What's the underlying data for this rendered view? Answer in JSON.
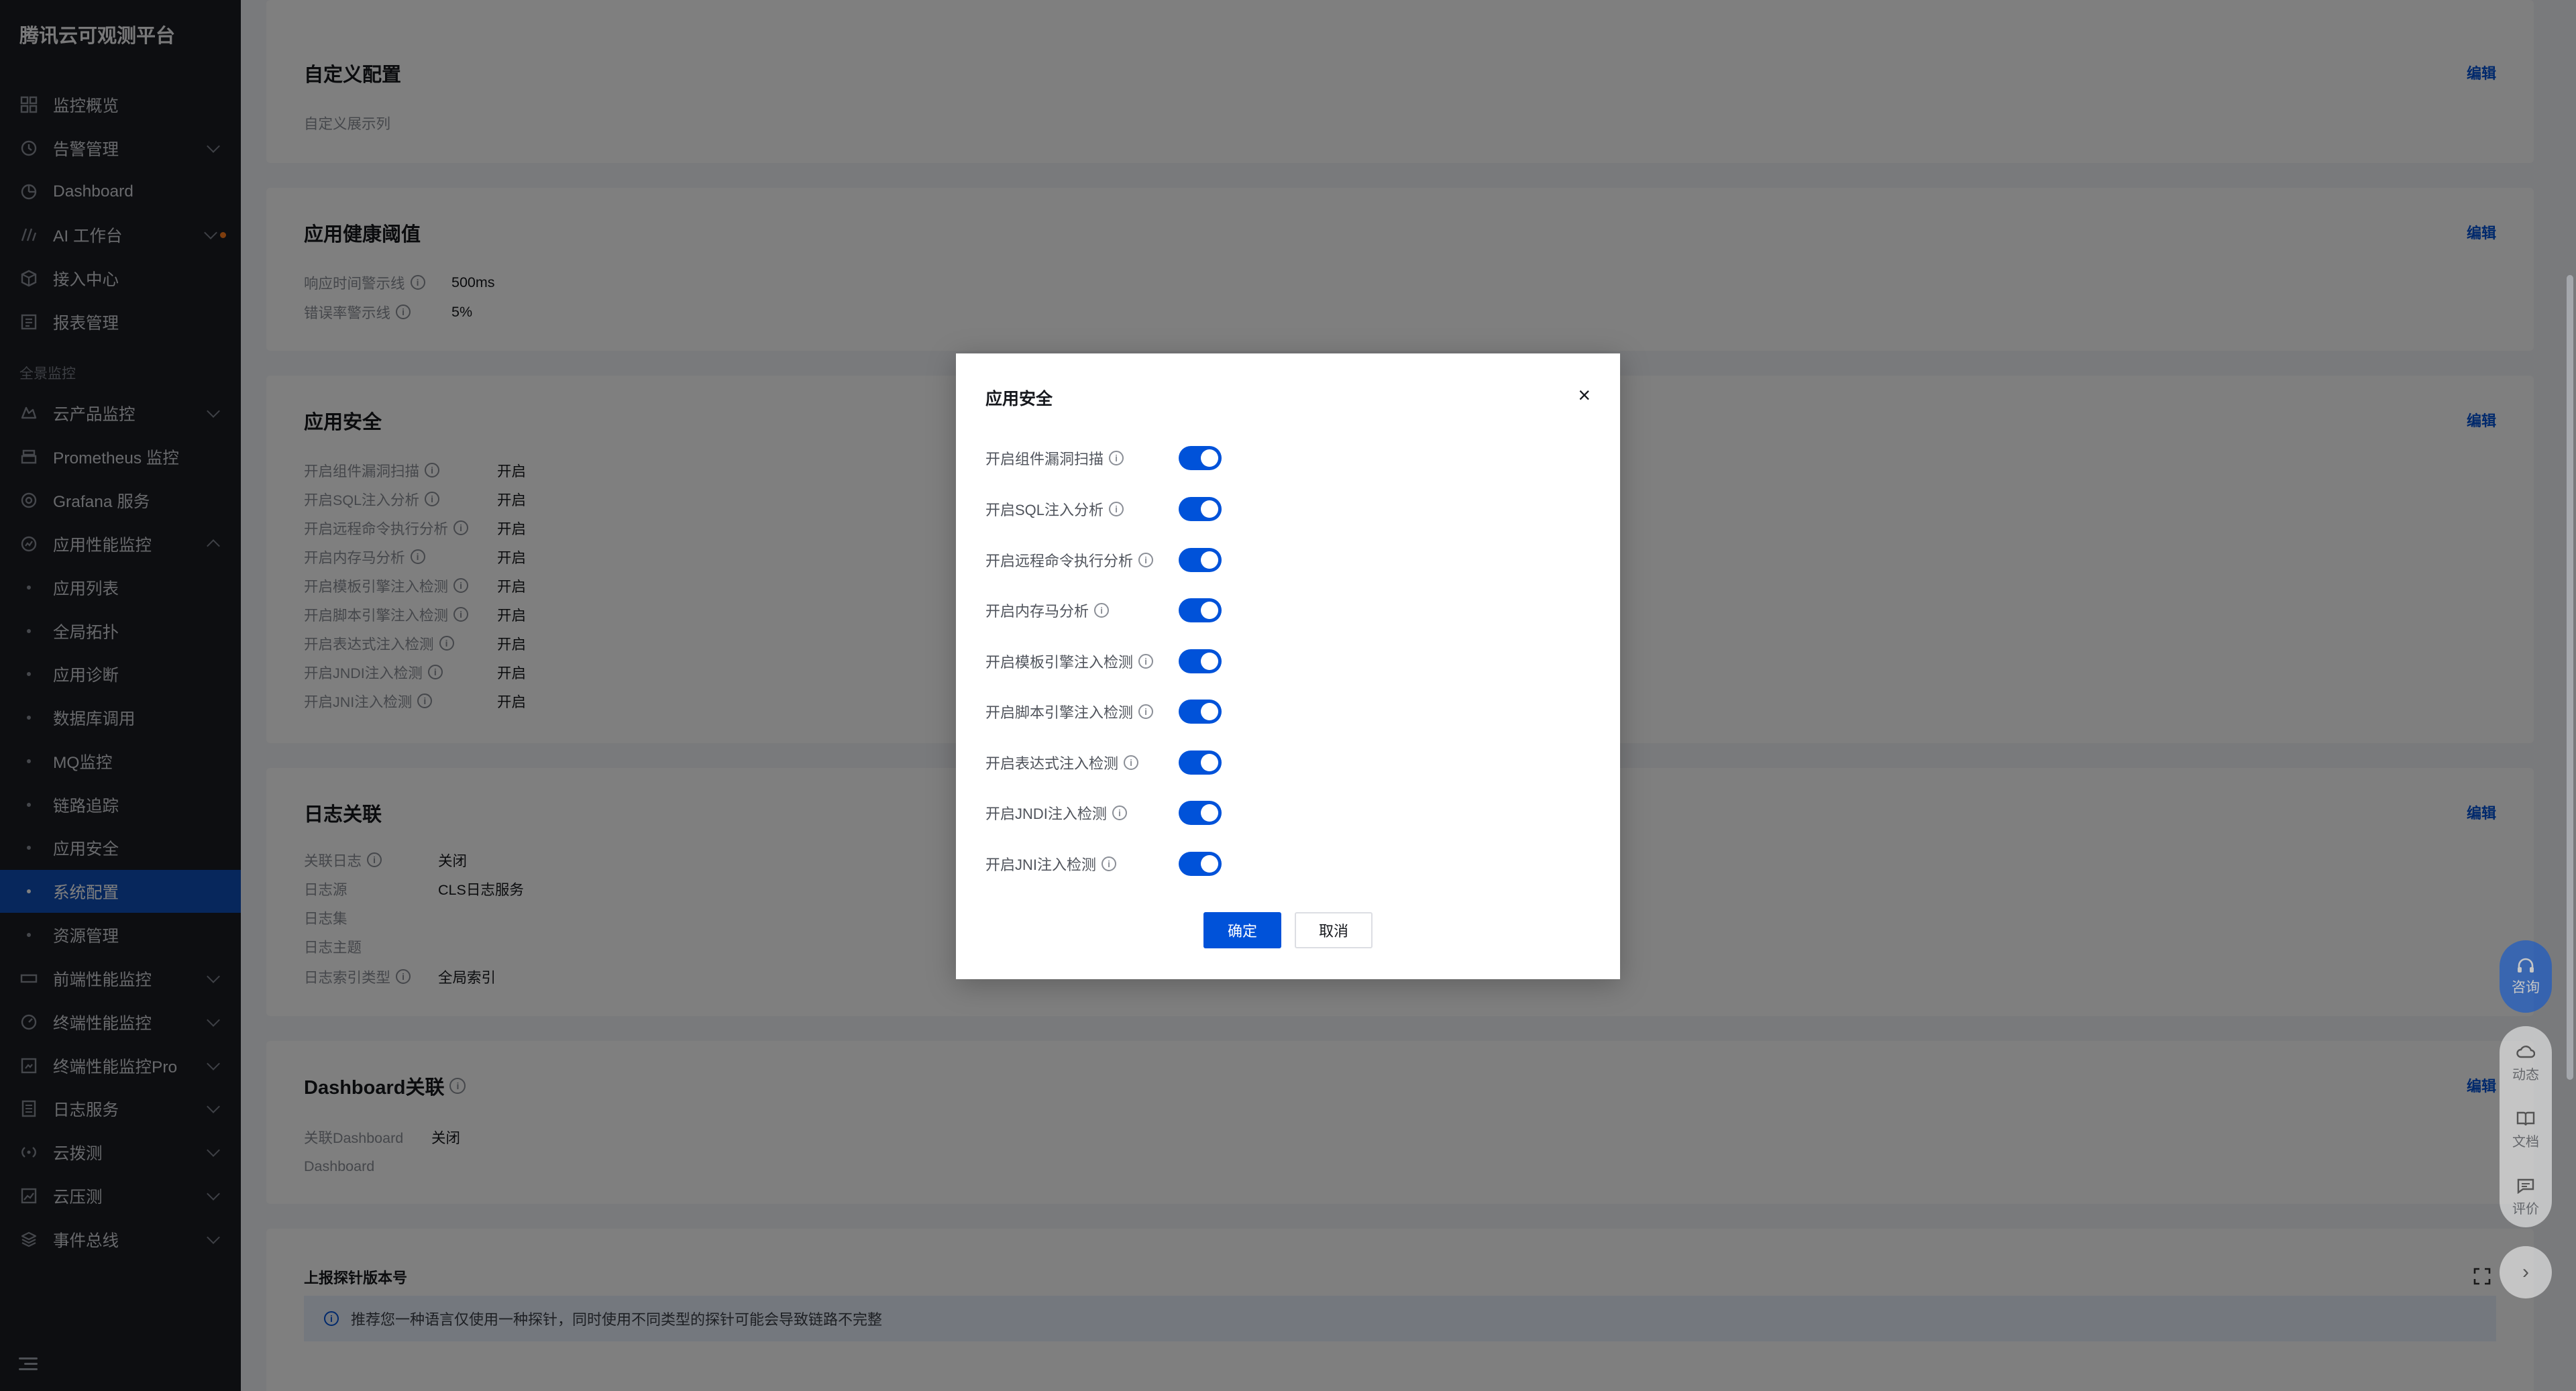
{
  "app_title": "腾讯云可观测平台",
  "sidebar": {
    "items_top": [
      {
        "label": "监控概览",
        "icon": "grid-icon"
      },
      {
        "label": "告警管理",
        "icon": "alarm-icon",
        "has_chevron": true
      },
      {
        "label": "Dashboard",
        "icon": "dashboard-icon"
      },
      {
        "label": "AI 工作台",
        "icon": "ai-icon",
        "has_chevron": true,
        "badge_dot": true
      },
      {
        "label": "接入中心",
        "icon": "cube-icon"
      },
      {
        "label": "报表管理",
        "icon": "report-icon"
      }
    ],
    "section_label": "全景监控",
    "items_main": [
      {
        "label": "云产品监控",
        "icon": "cloud-icon",
        "has_chevron": true
      },
      {
        "label": "Prometheus 监控",
        "icon": "prometheus-icon"
      },
      {
        "label": "Grafana 服务",
        "icon": "grafana-icon"
      },
      {
        "label": "应用性能监控",
        "icon": "apm-icon",
        "expanded": true
      }
    ],
    "apm_sub_items": [
      {
        "label": "应用列表"
      },
      {
        "label": "全局拓扑"
      },
      {
        "label": "应用诊断"
      },
      {
        "label": "数据库调用"
      },
      {
        "label": "MQ监控"
      },
      {
        "label": "链路追踪"
      },
      {
        "label": "应用安全"
      },
      {
        "label": "系统配置",
        "active": true
      },
      {
        "label": "资源管理"
      }
    ],
    "items_bottom": [
      {
        "label": "前端性能监控",
        "icon": "frontend-icon"
      },
      {
        "label": "终端性能监控",
        "icon": "terminal-icon"
      },
      {
        "label": "终端性能监控Pro",
        "icon": "terminal-pro-icon"
      },
      {
        "label": "日志服务",
        "icon": "log-icon"
      },
      {
        "label": "云拨测",
        "icon": "probe-icon"
      },
      {
        "label": "云压测",
        "icon": "pressure-icon"
      },
      {
        "label": "事件总线",
        "icon": "eventbus-icon"
      }
    ]
  },
  "cards": {
    "custom": {
      "title": "自定义配置",
      "edit": "编辑",
      "desc": "自定义展示列"
    },
    "health": {
      "title": "应用健康阈值",
      "edit": "编辑",
      "rows": [
        {
          "key": "响应时间警示线",
          "value": "500ms"
        },
        {
          "key": "错误率警示线",
          "value": "5%"
        }
      ]
    },
    "security": {
      "title": "应用安全",
      "edit": "编辑",
      "rows": [
        {
          "key": "开启组件漏洞扫描",
          "value": "开启"
        },
        {
          "key": "开启SQL注入分析",
          "value": "开启"
        },
        {
          "key": "开启远程命令执行分析",
          "value": "开启"
        },
        {
          "key": "开启内存马分析",
          "value": "开启"
        },
        {
          "key": "开启模板引擎注入检测",
          "value": "开启"
        },
        {
          "key": "开启脚本引擎注入检测",
          "value": "开启"
        },
        {
          "key": "开启表达式注入检测",
          "value": "开启"
        },
        {
          "key": "开启JNDI注入检测",
          "value": "开启"
        },
        {
          "key": "开启JNI注入检测",
          "value": "开启"
        }
      ]
    },
    "log": {
      "title": "日志关联",
      "edit": "编辑",
      "rows": [
        {
          "key": "关联日志",
          "value": "关闭",
          "info": true
        },
        {
          "key": "日志源",
          "value": "CLS日志服务",
          "info": false
        },
        {
          "key": "日志集",
          "value": "",
          "info": false
        },
        {
          "key": "日志主题",
          "value": "",
          "info": false
        },
        {
          "key": "日志索引类型",
          "value": "全局索引",
          "info": true
        }
      ]
    },
    "dashboard": {
      "title": "Dashboard关联",
      "edit": "编辑",
      "rows": [
        {
          "key": "关联Dashboard",
          "value": "关闭"
        },
        {
          "key": "Dashboard",
          "value": ""
        }
      ]
    },
    "probe": {
      "title": "上报探针版本号",
      "notice": "推荐您一种语言仅使用一种探针，同时使用不同类型的探针可能会导致链路不完整"
    }
  },
  "floating": {
    "consult": "咨询",
    "tools": [
      {
        "label": "动态",
        "icon": "cloud-update-icon"
      },
      {
        "label": "文档",
        "icon": "book-icon"
      },
      {
        "label": "评价",
        "icon": "comment-icon"
      }
    ],
    "expand": "›"
  },
  "dialog": {
    "title": "应用安全",
    "close": "×",
    "switches": [
      {
        "label": "开启组件漏洞扫描",
        "on": true
      },
      {
        "label": "开启SQL注入分析",
        "on": true
      },
      {
        "label": "开启远程命令执行分析",
        "on": true
      },
      {
        "label": "开启内存马分析",
        "on": true
      },
      {
        "label": "开启模板引擎注入检测",
        "on": true
      },
      {
        "label": "开启脚本引擎注入检测",
        "on": true
      },
      {
        "label": "开启表达式注入检测",
        "on": true
      },
      {
        "label": "开启JNDI注入检测",
        "on": true
      },
      {
        "label": "开启JNI注入检测",
        "on": true
      }
    ],
    "confirm": "确定",
    "cancel": "取消"
  },
  "colors": {
    "brand": "#0052d9",
    "sidebar_bg": "#1b1d22",
    "active_bg": "#0f4fb8"
  }
}
